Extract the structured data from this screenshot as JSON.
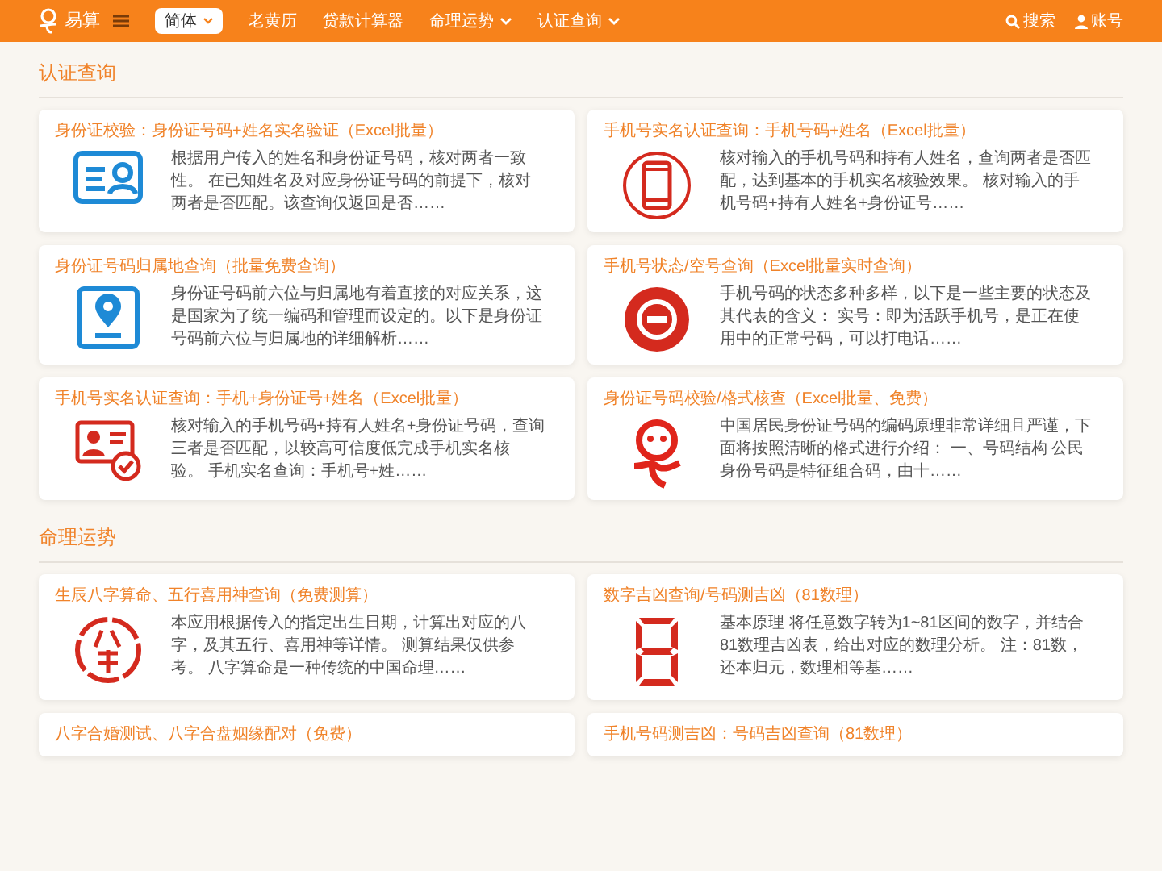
{
  "nav": {
    "brand": "易算",
    "language": "简体",
    "links": [
      {
        "label": "老黄历",
        "dropdown": false
      },
      {
        "label": "贷款计算器",
        "dropdown": false
      },
      {
        "label": "命理运势",
        "dropdown": true
      },
      {
        "label": "认证查询",
        "dropdown": true
      }
    ],
    "search": "搜索",
    "account": "账号"
  },
  "sections": [
    {
      "title": "认证查询",
      "cards": [
        {
          "title": "身份证校验：身份证号码+姓名实名验证（Excel批量）",
          "description": "根据用户传入的姓名和身份证号码，核对两者一致性。 在已知姓名及对应身份证号码的前提下，核对两者是否匹配。该查询仅返回是否……"
        },
        {
          "title": "手机号实名认证查询：手机号码+姓名（Excel批量）",
          "description": "核对输入的手机号码和持有人姓名，查询两者是否匹配，达到基本的手机实名核验效果。 核对输入的手机号码+持有人姓名+身份证号……"
        },
        {
          "title": "身份证号码归属地查询（批量免费查询）",
          "description": "身份证号码前六位与归属地有着直接的对应关系，这是国家为了统一编码和管理而设定的。以下是身份证号码前六位与归属地的详细解析……"
        },
        {
          "title": "手机号状态/空号查询（Excel批量实时查询）",
          "description": "手机号码的状态多种多样，以下是一些主要的状态及其代表的含义： 实号：即为活跃手机号，是正在使用中的正常号码，可以打电话……"
        },
        {
          "title": "手机号实名认证查询：手机+身份证号+姓名（Excel批量）",
          "description": "核对输入的手机号码+持有人姓名+身份证号码，查询三者是否匹配，以较高可信度低完成手机实名核验。 手机实名查询：手机号+姓……"
        },
        {
          "title": "身份证号码校验/格式核查（Excel批量、免费）",
          "description": "中国居民身份证号码的编码原理非常详细且严谨，下面将按照清晰的格式进行介绍： 一、号码结构 公民身份号码是特征组合码，由十……"
        }
      ]
    },
    {
      "title": "命理运势",
      "cards": [
        {
          "title": "生辰八字算命、五行喜用神查询（免费测算）",
          "description": "本应用根据传入的指定出生日期，计算出对应的八字，及其五行、喜用神等详情。 测算结果仅供参考。 八字算命是一种传统的中国命理……"
        },
        {
          "title": "数字吉凶查询/号码测吉凶（81数理）",
          "description": "基本原理 将任意数字转为1~81区间的数字，并结合81数理吉凶表，给出对应的数理分析。 注：81数，还本归元，数理相等基……"
        },
        {
          "title": "八字合婚测试、八字合盘姻缘配对（免费）"
        },
        {
          "title": "手机号码测吉凶：号码吉凶查询（81数理）"
        }
      ]
    }
  ]
}
